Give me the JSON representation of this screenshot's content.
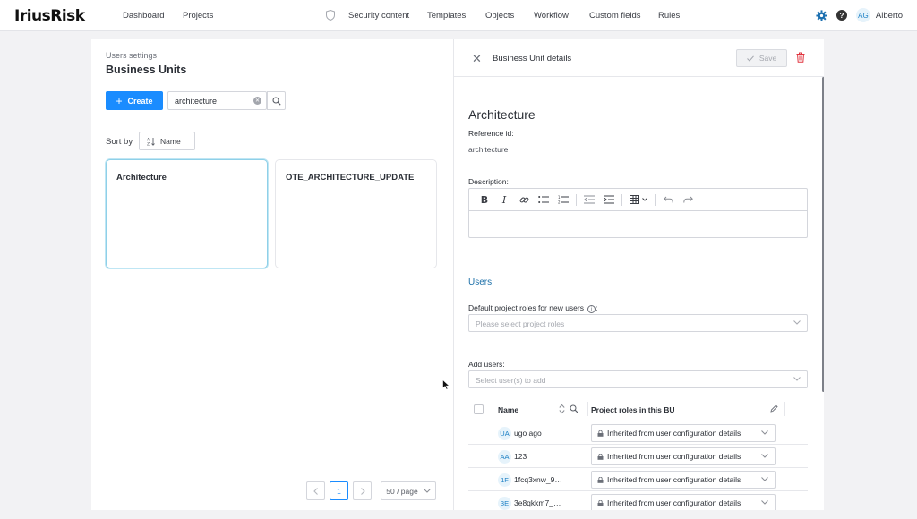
{
  "app": {
    "logo": "IriusRisk"
  },
  "nav": {
    "dashboard": "Dashboard",
    "projects": "Projects",
    "security_content": "Security content",
    "templates": "Templates",
    "objects": "Objects",
    "workflow": "Workflow",
    "custom_fields": "Custom fields",
    "rules": "Rules"
  },
  "user": {
    "initials": "AG",
    "name": "Alberto"
  },
  "left": {
    "breadcrumb": "Users settings",
    "title": "Business Units",
    "create_label": "Create",
    "search_value": "architecture",
    "sort_label": "Sort by",
    "sort_value": "Name",
    "cards": [
      {
        "title": "Architecture"
      },
      {
        "title": "OTE_ARCHITECTURE_UPDATE"
      }
    ],
    "pagination": {
      "current_page": "1",
      "page_size": "50 / page"
    }
  },
  "detail": {
    "header_title": "Business Unit details",
    "save_label": "Save",
    "name": "Architecture",
    "reference_label": "Reference id:",
    "reference_value": "architecture",
    "description_label": "Description:",
    "users_heading": "Users",
    "default_roles_label": "Default project roles for new users",
    "default_roles_placeholder": "Please select project roles",
    "add_users_label": "Add users:",
    "add_users_placeholder": "Select user(s) to add",
    "columns": {
      "name": "Name",
      "roles": "Project roles in this BU"
    },
    "users": [
      {
        "initials": "UA",
        "name": "ugo ago",
        "role": "Inherited from user configuration details"
      },
      {
        "initials": "AA",
        "name": "123",
        "role": "Inherited from user configuration details"
      },
      {
        "initials": "1F",
        "name": "1fcq3xnw_9…",
        "role": "Inherited from user configuration details"
      },
      {
        "initials": "3E",
        "name": "3e8qkkm7_…",
        "role": "Inherited from user configuration details"
      }
    ]
  },
  "colors": {
    "accent": "#1a8cff",
    "selected_card_border": "#8fd0e8",
    "users_heading": "#1b6fa8"
  }
}
